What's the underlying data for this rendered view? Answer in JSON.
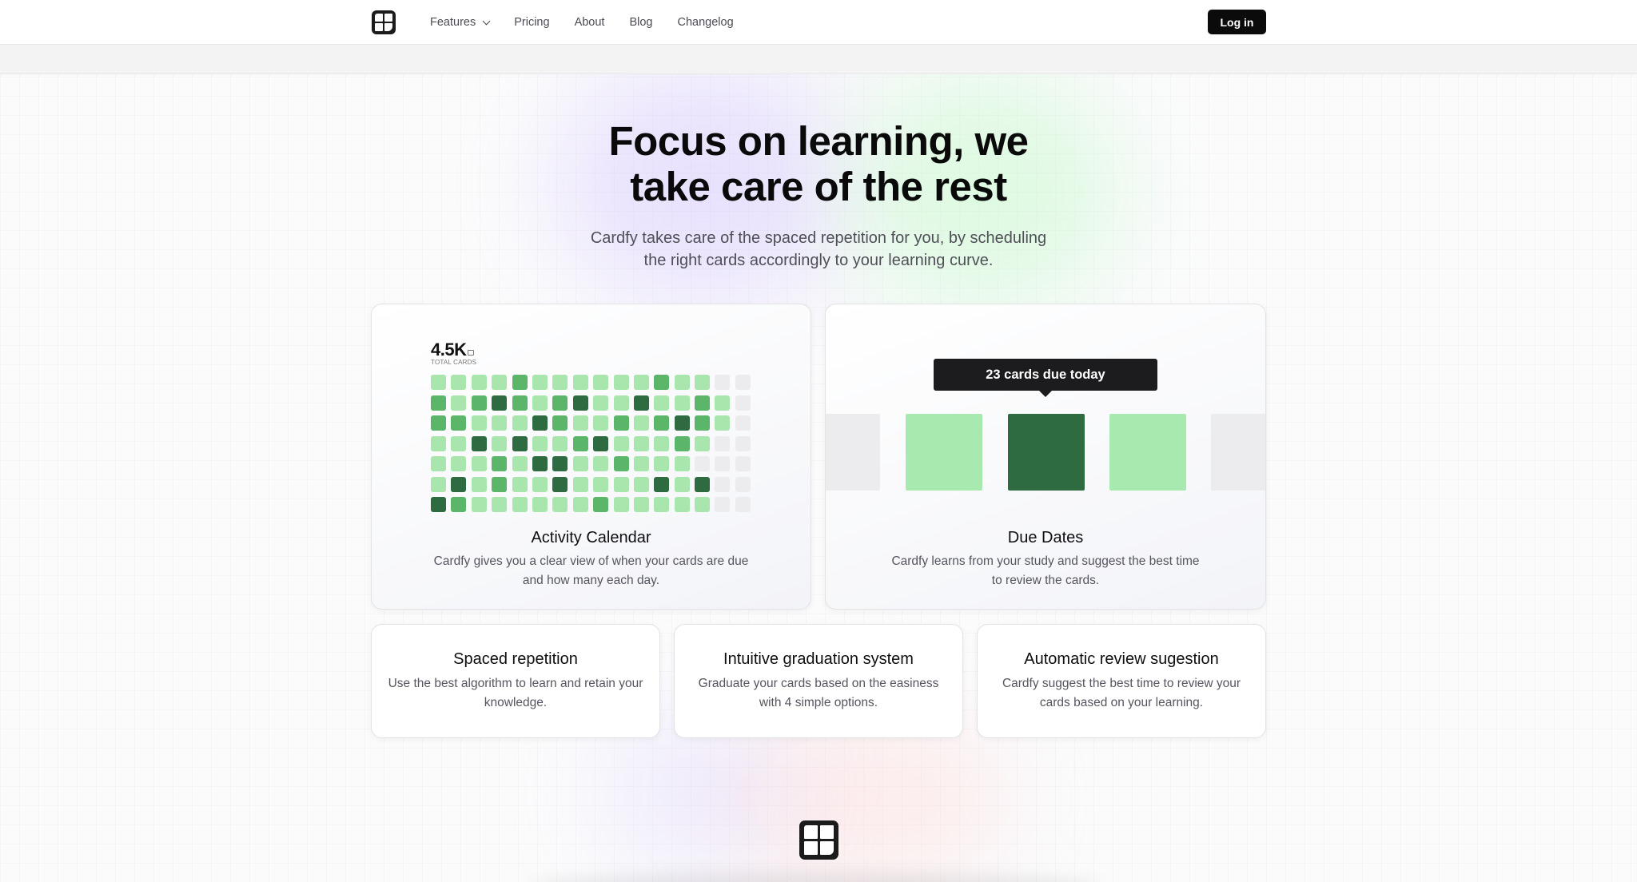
{
  "nav": {
    "items": [
      "Features",
      "Pricing",
      "About",
      "Blog",
      "Changelog"
    ],
    "login_label": "Log in"
  },
  "hero": {
    "title": "Focus on learning, we take care of the rest",
    "subtitle": "Cardfy takes care of the spaced repetition for you, by scheduling the right cards accordingly to your learning curve."
  },
  "activity": {
    "stat_value": "4.5K",
    "stat_label": "TOTAL CARDS",
    "title": "Activity Calendar",
    "description": "Cardfy gives you a clear view of when your cards are due and how many each day.",
    "levels": [
      [
        1,
        1,
        1,
        1,
        2,
        1,
        1,
        1,
        1,
        1,
        1,
        2,
        1,
        1,
        0,
        0
      ],
      [
        2,
        1,
        2,
        3,
        2,
        1,
        2,
        3,
        1,
        1,
        3,
        1,
        1,
        2,
        1,
        0
      ],
      [
        2,
        2,
        1,
        1,
        1,
        3,
        2,
        1,
        1,
        2,
        1,
        2,
        3,
        2,
        1,
        0
      ],
      [
        1,
        1,
        3,
        1,
        3,
        1,
        1,
        2,
        3,
        1,
        1,
        1,
        2,
        1,
        0,
        0
      ],
      [
        1,
        1,
        1,
        2,
        1,
        3,
        3,
        1,
        1,
        2,
        1,
        1,
        1,
        0,
        0,
        0
      ],
      [
        1,
        3,
        1,
        2,
        1,
        1,
        3,
        1,
        1,
        1,
        1,
        3,
        1,
        3,
        0,
        0
      ],
      [
        3,
        2,
        1,
        1,
        1,
        1,
        1,
        1,
        2,
        1,
        1,
        1,
        1,
        1,
        0,
        0
      ]
    ],
    "colors": [
      "#ececef",
      "#a8e6ad",
      "#5bb66a",
      "#2f6b40"
    ]
  },
  "due": {
    "tooltip": "23 cards due today",
    "title": "Due Dates",
    "description": "Cardfy learns from your study and suggest the best time to review the cards."
  },
  "features": [
    {
      "title": "Spaced repetition",
      "description": "Use the best algorithm to learn and retain your knowledge."
    },
    {
      "title": "Intuitive graduation system",
      "description": "Graduate your cards based on the easiness with 4 simple options."
    },
    {
      "title": "Automatic review sugestion",
      "description": "Cardfy suggest the best time to review your cards based on your learning."
    }
  ]
}
